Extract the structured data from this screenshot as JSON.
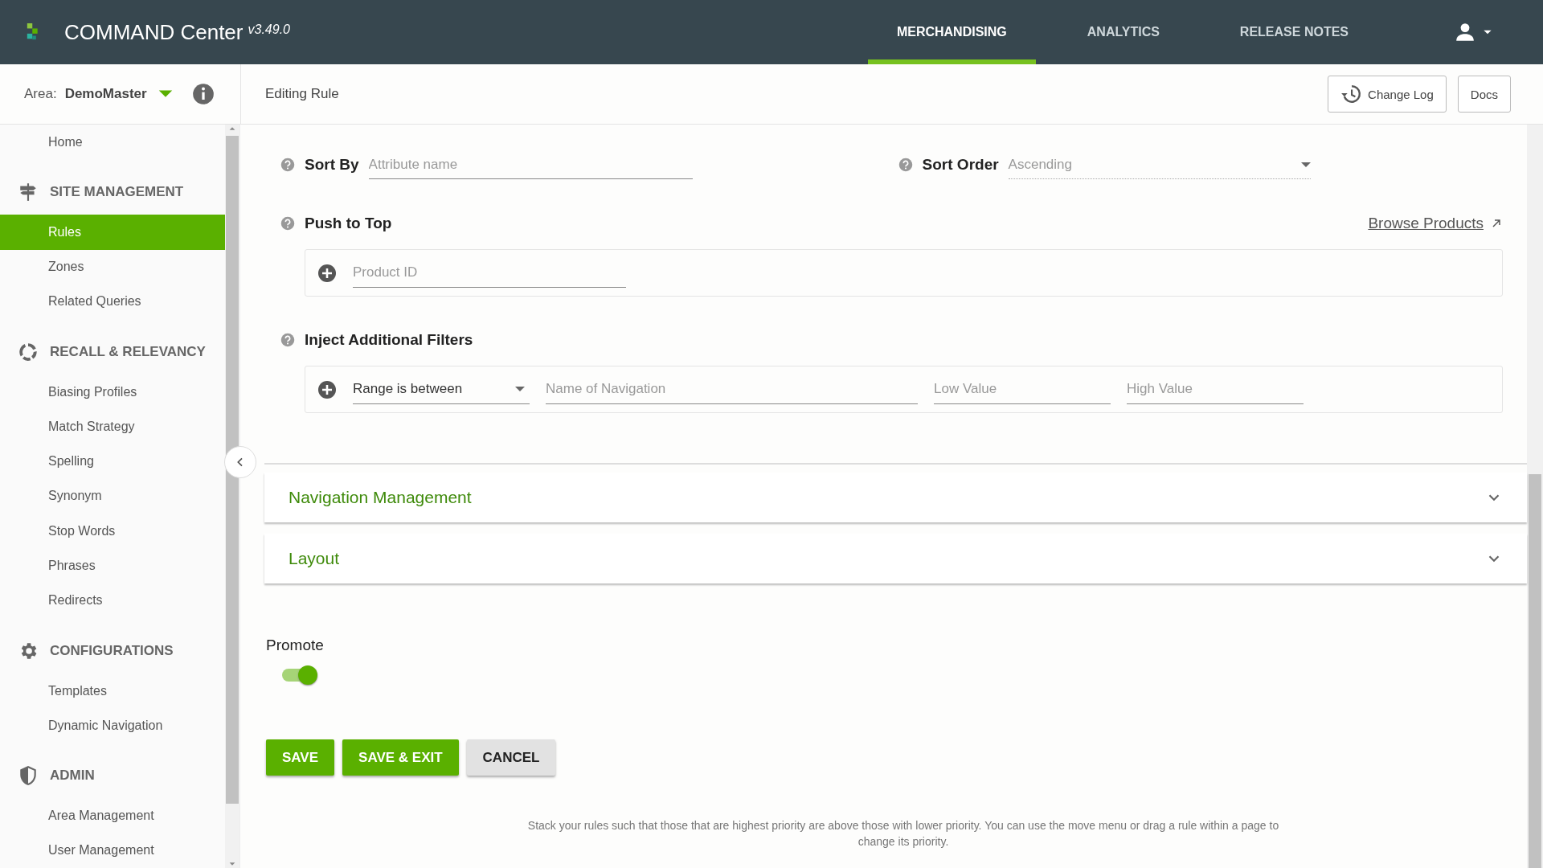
{
  "header": {
    "app_name": "COMMAND Center",
    "version": "v3.49.0",
    "tabs": [
      {
        "label": "MERCHANDISING",
        "selected": true
      },
      {
        "label": "ANALYTICS",
        "selected": false
      },
      {
        "label": "RELEASE NOTES",
        "selected": false
      }
    ]
  },
  "area": {
    "label": "Area:",
    "value": "DemoMaster"
  },
  "toolbar": {
    "title": "Editing Rule",
    "buttons": [
      {
        "label": "Change Log",
        "kind": "history"
      },
      {
        "label": "Docs",
        "kind": "plain"
      }
    ]
  },
  "sidebar": {
    "items": [
      {
        "kind": "link",
        "label": "Home",
        "selected": false
      },
      {
        "kind": "section",
        "label": "SITE MANAGEMENT"
      },
      {
        "kind": "link",
        "label": "Rules",
        "selected": true
      },
      {
        "kind": "link",
        "label": "Zones",
        "selected": false
      },
      {
        "kind": "link",
        "label": "Related Queries",
        "selected": false
      },
      {
        "kind": "section",
        "label": "RECALL & RELEVANCY"
      },
      {
        "kind": "link",
        "label": "Biasing Profiles",
        "selected": false
      },
      {
        "kind": "link",
        "label": "Match Strategy",
        "selected": false
      },
      {
        "kind": "link",
        "label": "Spelling",
        "selected": false
      },
      {
        "kind": "link",
        "label": "Synonym",
        "selected": false
      },
      {
        "kind": "link",
        "label": "Stop Words",
        "selected": false
      },
      {
        "kind": "link",
        "label": "Phrases",
        "selected": false
      },
      {
        "kind": "link",
        "label": "Redirects",
        "selected": false
      },
      {
        "kind": "section",
        "label": "CONFIGURATIONS"
      },
      {
        "kind": "link",
        "label": "Templates",
        "selected": false
      },
      {
        "kind": "link",
        "label": "Dynamic Navigation",
        "selected": false
      },
      {
        "kind": "section",
        "label": "ADMIN"
      },
      {
        "kind": "link",
        "label": "Area Management",
        "selected": false
      },
      {
        "kind": "link",
        "label": "User Management",
        "selected": false
      }
    ]
  },
  "form": {
    "sort_by": {
      "label": "Sort By",
      "placeholder": "Attribute name"
    },
    "sort_order": {
      "label": "Sort Order",
      "placeholder": "Ascending"
    },
    "push_to_top": {
      "label": "Push to Top",
      "link": "Browse Products",
      "placeholder": "Product ID"
    },
    "inject_filters": {
      "label": "Inject Additional Filters",
      "range": "Range is between",
      "placeholders": [
        "Name of Navigation",
        "Low Value",
        "High Value"
      ]
    }
  },
  "panels": [
    {
      "title": "Navigation Management",
      "expanded": false
    },
    {
      "title": "Layout",
      "expanded": false
    }
  ],
  "promote": {
    "label": "Promote",
    "on": true
  },
  "actions": [
    {
      "label": "SAVE",
      "kind": "primary"
    },
    {
      "label": "SAVE & EXIT",
      "kind": "primary"
    },
    {
      "label": "CANCEL",
      "kind": "secondary"
    }
  ],
  "footer_note": "Stack your rules such that those that are highest priority are above those with lower priority. You can use the move menu or drag a rule within a page to change its priority."
}
